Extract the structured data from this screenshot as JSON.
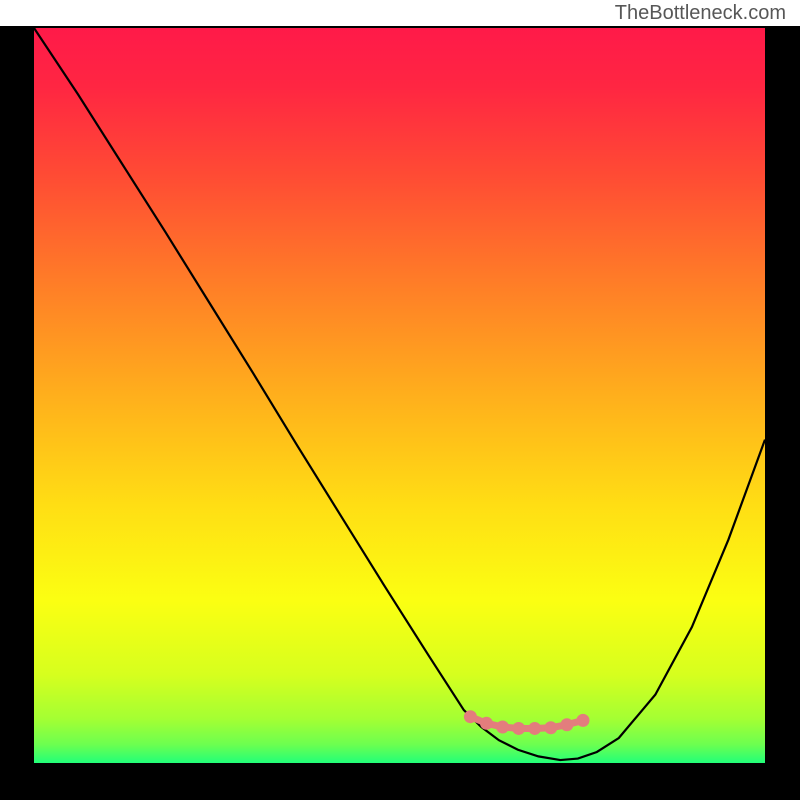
{
  "watermark": "TheBottleneck.com",
  "chart_data": {
    "type": "line",
    "title": "",
    "xlabel": "",
    "ylabel": "",
    "xlim": [
      0,
      1
    ],
    "ylim": [
      0,
      1
    ],
    "gradient_stops": [
      {
        "offset": 0.0,
        "color": "#ff1a49"
      },
      {
        "offset": 0.08,
        "color": "#ff2642"
      },
      {
        "offset": 0.2,
        "color": "#ff4b34"
      },
      {
        "offset": 0.35,
        "color": "#ff7e27"
      },
      {
        "offset": 0.5,
        "color": "#ffaf1c"
      },
      {
        "offset": 0.65,
        "color": "#ffde14"
      },
      {
        "offset": 0.78,
        "color": "#fbff12"
      },
      {
        "offset": 0.88,
        "color": "#d6ff1e"
      },
      {
        "offset": 0.94,
        "color": "#a4ff33"
      },
      {
        "offset": 0.975,
        "color": "#6cff50"
      },
      {
        "offset": 1.0,
        "color": "#22ff79"
      }
    ],
    "series": [
      {
        "name": "bottleneck-curve",
        "stroke": "#000000",
        "x": [
          0.0,
          0.06,
          0.12,
          0.18,
          0.24,
          0.3,
          0.36,
          0.42,
          0.48,
          0.54,
          0.588,
          0.612,
          0.636,
          0.662,
          0.69,
          0.72,
          0.744,
          0.77,
          0.8,
          0.85,
          0.9,
          0.95,
          1.0
        ],
        "y": [
          1.0,
          0.91,
          0.816,
          0.722,
          0.626,
          0.53,
          0.432,
          0.336,
          0.24,
          0.146,
          0.072,
          0.049,
          0.031,
          0.018,
          0.009,
          0.004,
          0.006,
          0.015,
          0.034,
          0.093,
          0.185,
          0.304,
          0.44
        ]
      }
    ],
    "markers": {
      "name": "highlight-band",
      "fill": "#e37d7d",
      "stroke": "#e37d7d",
      "x": [
        0.597,
        0.619,
        0.641,
        0.663,
        0.685,
        0.707,
        0.729,
        0.751
      ],
      "y": [
        0.063,
        0.054,
        0.049,
        0.047,
        0.047,
        0.048,
        0.052,
        0.058
      ]
    }
  }
}
